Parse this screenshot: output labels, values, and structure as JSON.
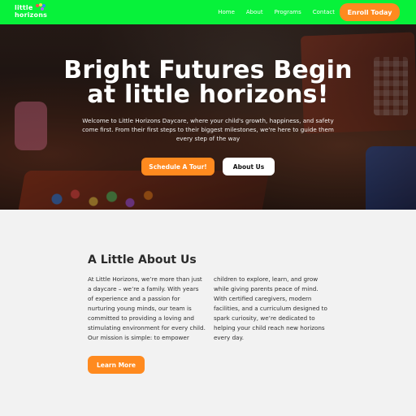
{
  "header": {
    "logo_line1": "little",
    "logo_line2": "horizons",
    "nav_links": [
      "Home",
      "About",
      "Programs",
      "Contact"
    ],
    "cta_label": "Enroll Today",
    "colors": {
      "nav_bg": "#07f23a",
      "accent": "#ff8a1f"
    }
  },
  "hero": {
    "title_line1": "Bright Futures Begin",
    "title_line2": "at little horizons!",
    "subtitle": "Welcome to Little Horizons Daycare, where your child's growth, happiness, and safety come first. From their first steps to their biggest milestones, we're here to guide them every step of the way",
    "primary_button": "Schedule A Tour!",
    "secondary_button": "About Us"
  },
  "about": {
    "title": "A Little About Us",
    "body": "At Little Horizons, we’re more than just a daycare – we’re a family. With years of experience and a passion for nurturing young minds, our team is committed to providing a loving and stimulating environment for every child. Our mission is simple: to empower children to explore, learn, and grow while giving parents peace of mind. With certified caregivers, modern facilities, and a curriculum designed to spark curiosity, we’re dedicated to helping your child reach new horizons every day.",
    "button": "Learn More"
  }
}
